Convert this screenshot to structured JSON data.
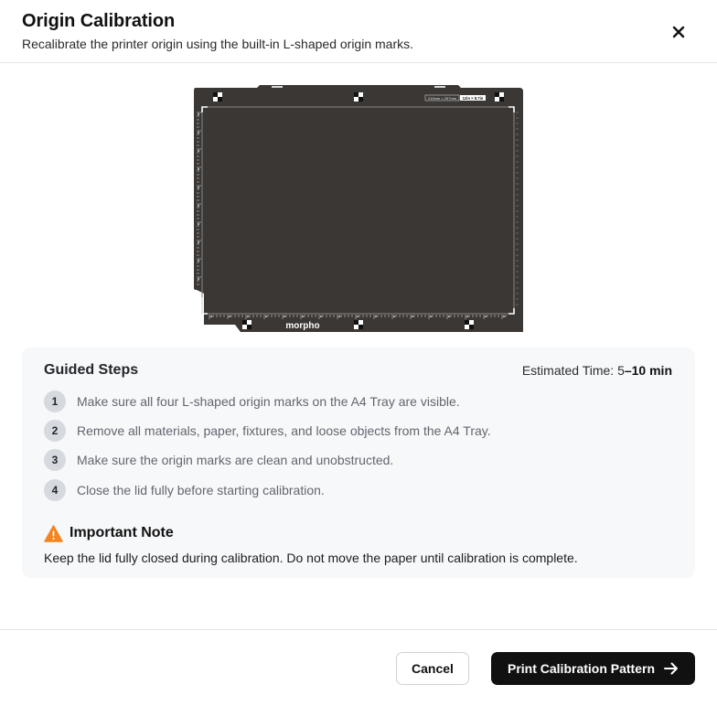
{
  "dialog": {
    "title": "Origin Calibration",
    "subtitle": "Recalibrate the printer origin using the built-in L-shaped origin marks.",
    "close_icon": "close-icon"
  },
  "tray": {
    "brand": "morpho",
    "size_label_left": "210mm × 297mm",
    "size_label_right": "12in × 8.7in",
    "colors": {
      "tray": "#3a3735",
      "marks": "#ffffff"
    }
  },
  "guided_steps": {
    "title": "Guided Steps",
    "estimated_time_label": "Estimated Time: 5",
    "estimated_time_value": "–10 min",
    "steps": [
      {
        "number": "1",
        "text": "Make sure all four L-shaped origin marks on the A4 Tray are visible."
      },
      {
        "number": "2",
        "text": "Remove all materials, paper, fixtures, and loose objects from the A4 Tray."
      },
      {
        "number": "3",
        "text": "Make sure the origin marks are clean and unobstructed."
      },
      {
        "number": "4",
        "text": "Close the lid fully before starting calibration."
      }
    ]
  },
  "note": {
    "icon": "warning-icon",
    "title": "Important Note",
    "text": "Keep the lid fully closed during calibration. Do not move the paper until calibration is complete.",
    "icon_color": "#f5831f"
  },
  "footer": {
    "cancel_label": "Cancel",
    "print_label": "Print Calibration Pattern",
    "print_icon": "arrow-right-icon"
  }
}
